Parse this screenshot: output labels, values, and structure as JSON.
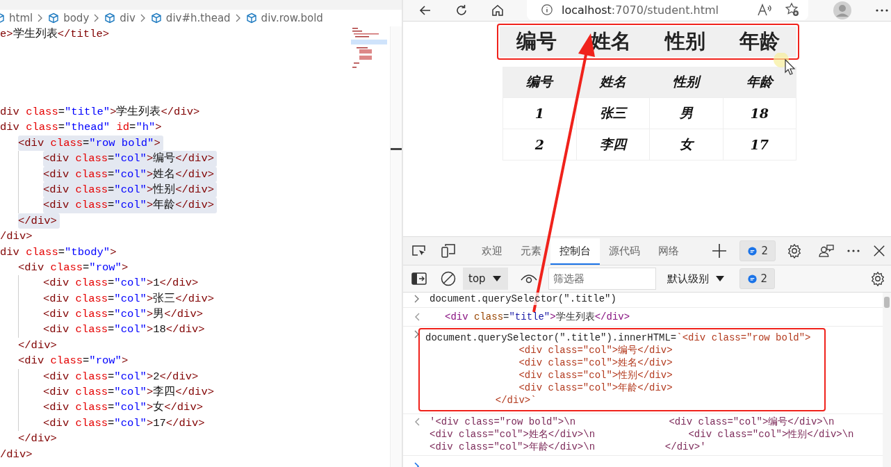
{
  "editor": {
    "breadcrumbs": [
      "html",
      "body",
      "div",
      "div#h.thead",
      "div.row.bold"
    ],
    "blocks": [
      {
        "lines": [
          {
            "text": "e>学生列表</title>",
            "highlighted": false
          }
        ]
      },
      {
        "lines": [
          {
            "text": "div class=\"title\">学生列表</div>",
            "highlighted": false
          },
          {
            "text": "div class=\"thead\" id=\"h\">",
            "highlighted": false,
            "children": [
              {
                "text": "<div class=\"row bold\">",
                "highlighted": true,
                "children": [
                  {
                    "text": "<div class=\"col\">编号</div>",
                    "highlighted": true
                  },
                  {
                    "text": "<div class=\"col\">姓名</div>",
                    "highlighted": true
                  },
                  {
                    "text": "<div class=\"col\">性别</div>",
                    "highlighted": true
                  },
                  {
                    "text": "<div class=\"col\">年龄</div>",
                    "highlighted": true
                  }
                ]
              },
              {
                "text": "</div>",
                "highlighted": true
              }
            ]
          },
          {
            "text": "/div>",
            "highlighted": false
          },
          {
            "text": "div class=\"tbody\">",
            "highlighted": false,
            "children": [
              {
                "text": "<div class=\"row\">",
                "highlighted": false,
                "children": [
                  {
                    "text": "<div class=\"col\">1</div>",
                    "highlighted": false
                  },
                  {
                    "text": "<div class=\"col\">张三</div>",
                    "highlighted": false
                  },
                  {
                    "text": "<div class=\"col\">男</div>",
                    "highlighted": false
                  },
                  {
                    "text": "<div class=\"col\">18</div>",
                    "highlighted": false
                  }
                ]
              },
              {
                "text": "</div>",
                "highlighted": false
              },
              {
                "text": "<div class=\"row\">",
                "highlighted": false,
                "children": [
                  {
                    "text": "<div class=\"col\">2</div>",
                    "highlighted": false
                  },
                  {
                    "text": "<div class=\"col\">李四</div>",
                    "highlighted": false
                  },
                  {
                    "text": "<div class=\"col\">女</div>",
                    "highlighted": false
                  },
                  {
                    "text": "<div class=\"col\">17</div>",
                    "highlighted": false
                  }
                ]
              },
              {
                "text": "</div>",
                "highlighted": false
              }
            ]
          },
          {
            "text": "/div>",
            "highlighted": false
          }
        ]
      }
    ]
  },
  "browser": {
    "url_host": "localhost",
    "url_path": ":7070/student.html"
  },
  "page": {
    "title_row": {
      "highlighted": true,
      "cells": [
        "编号",
        "姓名",
        "性别",
        "年龄"
      ]
    },
    "table": {
      "columns": [
        "编号",
        "姓名",
        "性别",
        "年龄"
      ],
      "rows": [
        [
          "1",
          "张三",
          "男",
          "18"
        ],
        [
          "2",
          "李四",
          "女",
          "17"
        ]
      ]
    }
  },
  "devtools": {
    "tabs": [
      {
        "label": "欢迎",
        "selected": false
      },
      {
        "label": "元素",
        "selected": false
      },
      {
        "label": "控制台",
        "selected": true
      },
      {
        "label": "源代码",
        "selected": false
      },
      {
        "label": "网络",
        "selected": false
      }
    ],
    "issues_count": "2",
    "context": "top",
    "filter_placeholder": "筛选器",
    "level": "默认级别",
    "messages_count": "2"
  },
  "console": {
    "entries": [
      {
        "kind": "input",
        "highlighted": false,
        "lines": [
          "document.querySelector(\".title\")"
        ]
      },
      {
        "kind": "element",
        "highlighted": false,
        "lines": [
          "<div class=\"title\">学生列表</div>"
        ]
      },
      {
        "kind": "input",
        "highlighted": true,
        "lines": [
          "document.querySelector(\".title\").innerHTML=`<div class=\"row bold\">",
          "                <div class=\"col\">编号</div>",
          "                <div class=\"col\">姓名</div>",
          "                <div class=\"col\">性别</div>",
          "                <div class=\"col\">年龄</div>",
          "            </div>`"
        ]
      },
      {
        "kind": "result",
        "highlighted": false,
        "lines": [
          "'<div class=\"row bold\">\\n                <div class=\"col\">编号</div>\\n",
          "<div class=\"col\">姓名</div>\\n                <div class=\"col\">性别</div>\\n",
          "<div class=\"col\">年龄</div>\\n            </div>'"
        ]
      }
    ]
  }
}
